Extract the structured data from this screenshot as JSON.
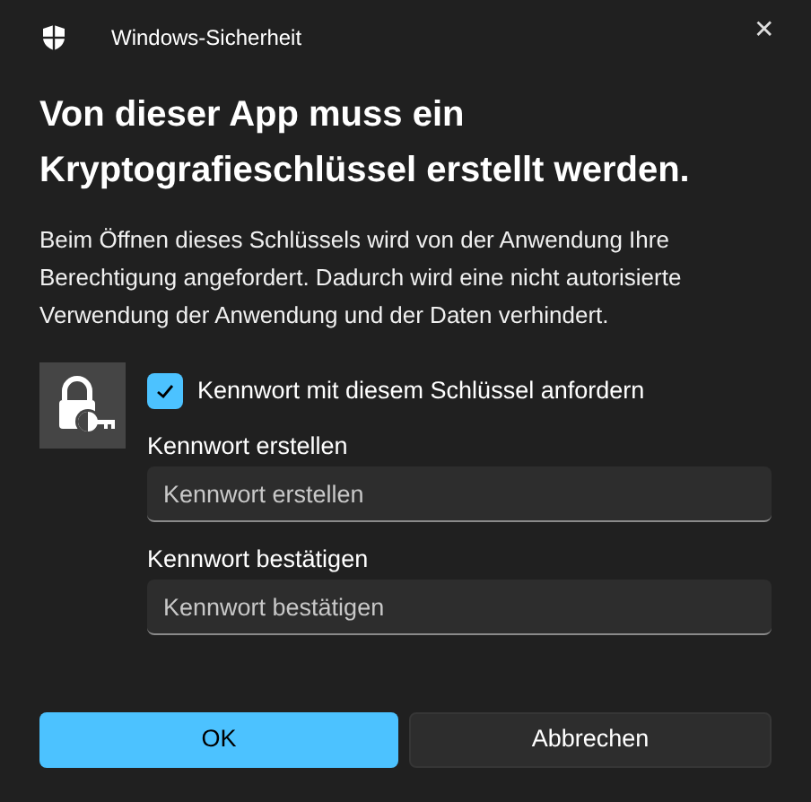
{
  "window": {
    "title": "Windows-Sicherheit",
    "close": "✕"
  },
  "heading": "Von dieser App muss ein Kryptografieschlüssel erstellt werden.",
  "description": "Beim Öffnen dieses Schlüssels wird von der Anwendung Ihre Berechtigung angefordert. Dadurch wird eine nicht autorisierte Verwendung der Anwendung und der Daten verhindert.",
  "require_password": {
    "label": "Kennwort mit diesem Schlüssel anfordern",
    "checked": true
  },
  "fields": [
    {
      "label": "Kennwort erstellen",
      "placeholder": "Kennwort erstellen"
    },
    {
      "label": "Kennwort bestätigen",
      "placeholder": "Kennwort bestätigen"
    }
  ],
  "buttons": [
    {
      "label": "OK",
      "kind": "primary"
    },
    {
      "label": "Abbrechen",
      "kind": "secondary"
    }
  ]
}
